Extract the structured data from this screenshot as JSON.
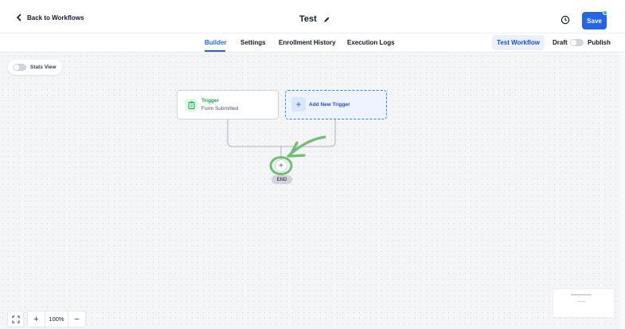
{
  "header": {
    "back_label": "Back to Workflows",
    "title": "Test",
    "save_label": "Save"
  },
  "tabs": [
    {
      "label": "Builder",
      "active": true
    },
    {
      "label": "Settings",
      "active": false
    },
    {
      "label": "Enrollment History",
      "active": false
    },
    {
      "label": "Execution Logs",
      "active": false
    }
  ],
  "actions": {
    "test_workflow_label": "Test Workflow",
    "draft_label": "Draft",
    "publish_label": "Publish"
  },
  "canvas": {
    "stats_view_label": "Stats View",
    "trigger_card": {
      "title": "Trigger",
      "subtitle": "Form Submitted",
      "icon": "clipboard-icon"
    },
    "add_trigger_label": "Add New Trigger",
    "add_step_symbol": "+",
    "end_label": "END"
  },
  "zoom": {
    "level": "100%",
    "plus": "+",
    "minus": "−"
  },
  "colors": {
    "accent": "#2563eb",
    "trigger_green": "#16a34a",
    "highlight_green": "#6fbf73"
  }
}
